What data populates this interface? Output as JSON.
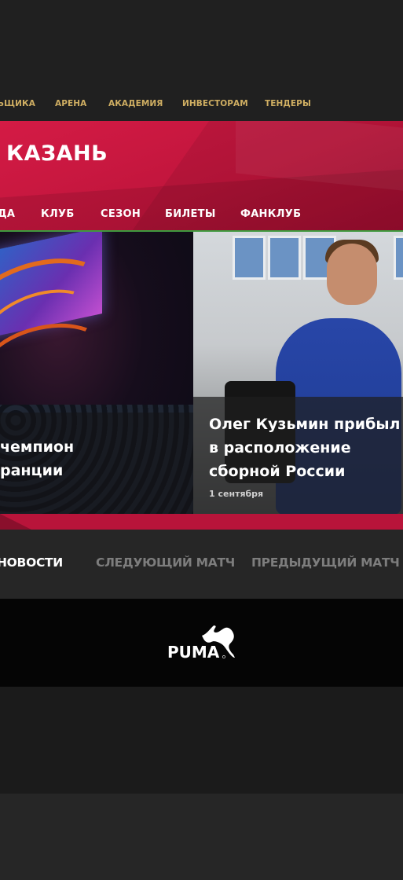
{
  "top_nav": {
    "items": [
      "ЬЩИКА",
      "АРЕНА",
      "АКАДЕМИЯ",
      "ИНВЕСТОРАМ",
      "ТЕНДЕРЫ"
    ]
  },
  "header": {
    "club_title": "КАЗАНЬ"
  },
  "main_nav": {
    "items": [
      "ДА",
      "КЛУБ",
      "СЕЗОН",
      "БИЛЕТЫ",
      "ФАНКЛУБ"
    ]
  },
  "slider": {
    "slides": [
      {
        "title_line1": "чемпион",
        "title_line2": "ранции"
      },
      {
        "title": "Олег Кузьмин прибыл в расположение сборной России",
        "date": "1 сентября"
      }
    ]
  },
  "tabs": {
    "items": [
      {
        "label": "НОВОСТИ",
        "active": true
      },
      {
        "label": "СЛЕДУЮЩИЙ МАТЧ",
        "active": false
      },
      {
        "label": "ПРЕДЫДУЩИЙ МАТЧ",
        "active": false
      }
    ],
    "colors": {
      "active": "#ffffff",
      "inactive": "#7d7d7d"
    }
  },
  "sponsor": {
    "logo_text": "PUMA"
  },
  "colors": {
    "brand_red": "#c0153c",
    "top_nav_gold": "#cfae62",
    "nav_underline_green": "#3f9a3e"
  }
}
